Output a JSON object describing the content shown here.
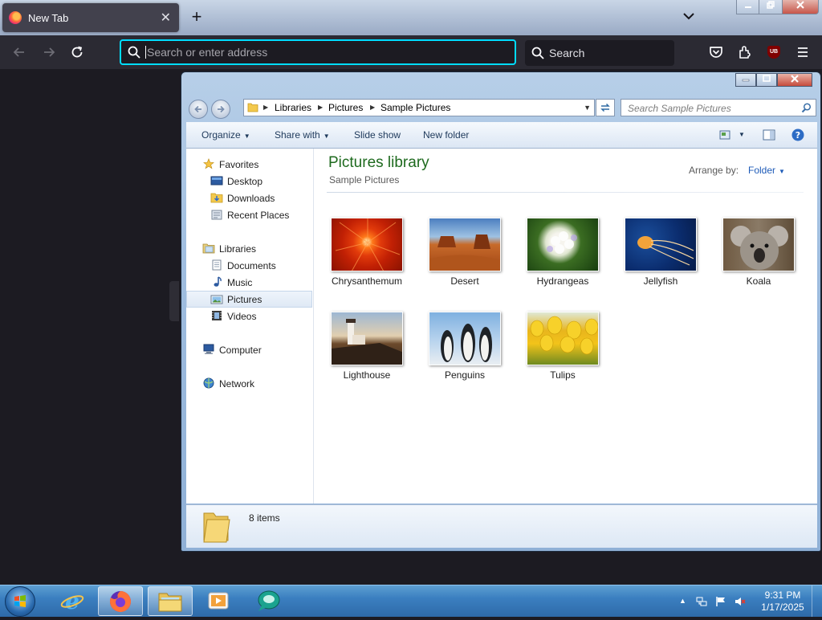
{
  "firefox": {
    "tab_title": "New Tab",
    "tab_close": "✕",
    "new_tab": "+",
    "url_placeholder": "Search or enter address",
    "search_placeholder": "Search",
    "ublock_label": "UB"
  },
  "explorer": {
    "breadcrumb": [
      "Libraries",
      "Pictures",
      "Sample Pictures"
    ],
    "search_placeholder": "Search Sample Pictures",
    "commands": {
      "organize": "Organize",
      "share_with": "Share with",
      "slide_show": "Slide show",
      "new_folder": "New folder"
    },
    "nav": {
      "favorites": "Favorites",
      "desktop": "Desktop",
      "downloads": "Downloads",
      "recent_places": "Recent Places",
      "libraries": "Libraries",
      "documents": "Documents",
      "music": "Music",
      "pictures": "Pictures",
      "videos": "Videos",
      "computer": "Computer",
      "network": "Network"
    },
    "library_title": "Pictures library",
    "library_subtitle": "Sample Pictures",
    "arrange_label": "Arrange by:",
    "arrange_value": "Folder",
    "pictures": [
      "Chrysanthemum",
      "Desert",
      "Hydrangeas",
      "Jellyfish",
      "Koala",
      "Lighthouse",
      "Penguins",
      "Tulips"
    ],
    "item_count": "8 items"
  },
  "taskbar": {
    "time": "9:31 PM",
    "date": "1/17/2025"
  },
  "colors": {
    "accent_focus": "#00ddff",
    "library_title": "#1e6a1e",
    "firefox_dark": "#2b2a33"
  }
}
